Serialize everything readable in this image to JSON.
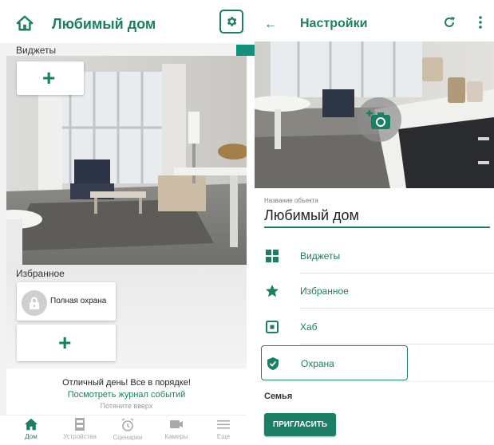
{
  "left_screen": {
    "header_title": "Любимый дом",
    "widgets_label": "Виджеты",
    "favorites_label": "Избранное",
    "favorite_card_label": "Полная охрана",
    "status_message": "Отличный день! Все в порядке!",
    "events_link": "Посмотреть журнал событий",
    "pull_hint": "Потяните вверх",
    "tabs": [
      {
        "label": "Дом",
        "icon": "home-icon"
      },
      {
        "label": "Устройства",
        "icon": "devices-icon"
      },
      {
        "label": "Сценарии",
        "icon": "alarm-clock-icon"
      },
      {
        "label": "Камеры",
        "icon": "camera-icon"
      },
      {
        "label": "Еще",
        "icon": "menu-icon"
      }
    ]
  },
  "right_screen": {
    "header_title": "Настройки",
    "field_label": "Название объекта",
    "field_value": "Любимый дом",
    "menu": [
      {
        "label": "Виджеты",
        "icon": "widgets-grid-icon"
      },
      {
        "label": "Избранное",
        "icon": "star-icon"
      },
      {
        "label": "Хаб",
        "icon": "hub-icon"
      },
      {
        "label": "Охрана",
        "icon": "shield-check-icon"
      }
    ],
    "family_label": "Семья",
    "invite_label": "ПРИГЛАСИТЬ"
  },
  "colors": {
    "accent": "#1a7f64",
    "inactive_tab": "#aaaaaa",
    "highlight_arrow": "#12907a"
  }
}
